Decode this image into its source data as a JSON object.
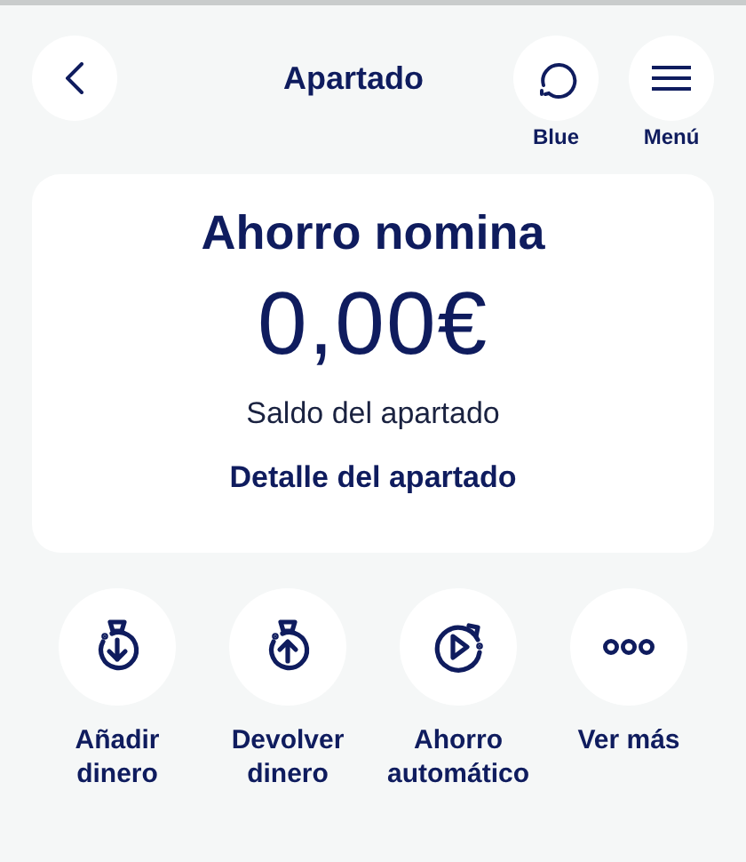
{
  "header": {
    "title": "Apartado",
    "actions": [
      {
        "kind": "chat",
        "label": "Blue"
      },
      {
        "kind": "menu",
        "label": "Menú"
      }
    ]
  },
  "card": {
    "title": "Ahorro nomina",
    "amount": "0,00€",
    "caption": "Saldo del apartado",
    "link": "Detalle del apartado"
  },
  "actions": [
    {
      "kind": "add",
      "label": "Añadir dinero"
    },
    {
      "kind": "return",
      "label": "Devolver dinero"
    },
    {
      "kind": "auto",
      "label": "Ahorro automático"
    },
    {
      "kind": "more",
      "label": "Ver más"
    }
  ]
}
